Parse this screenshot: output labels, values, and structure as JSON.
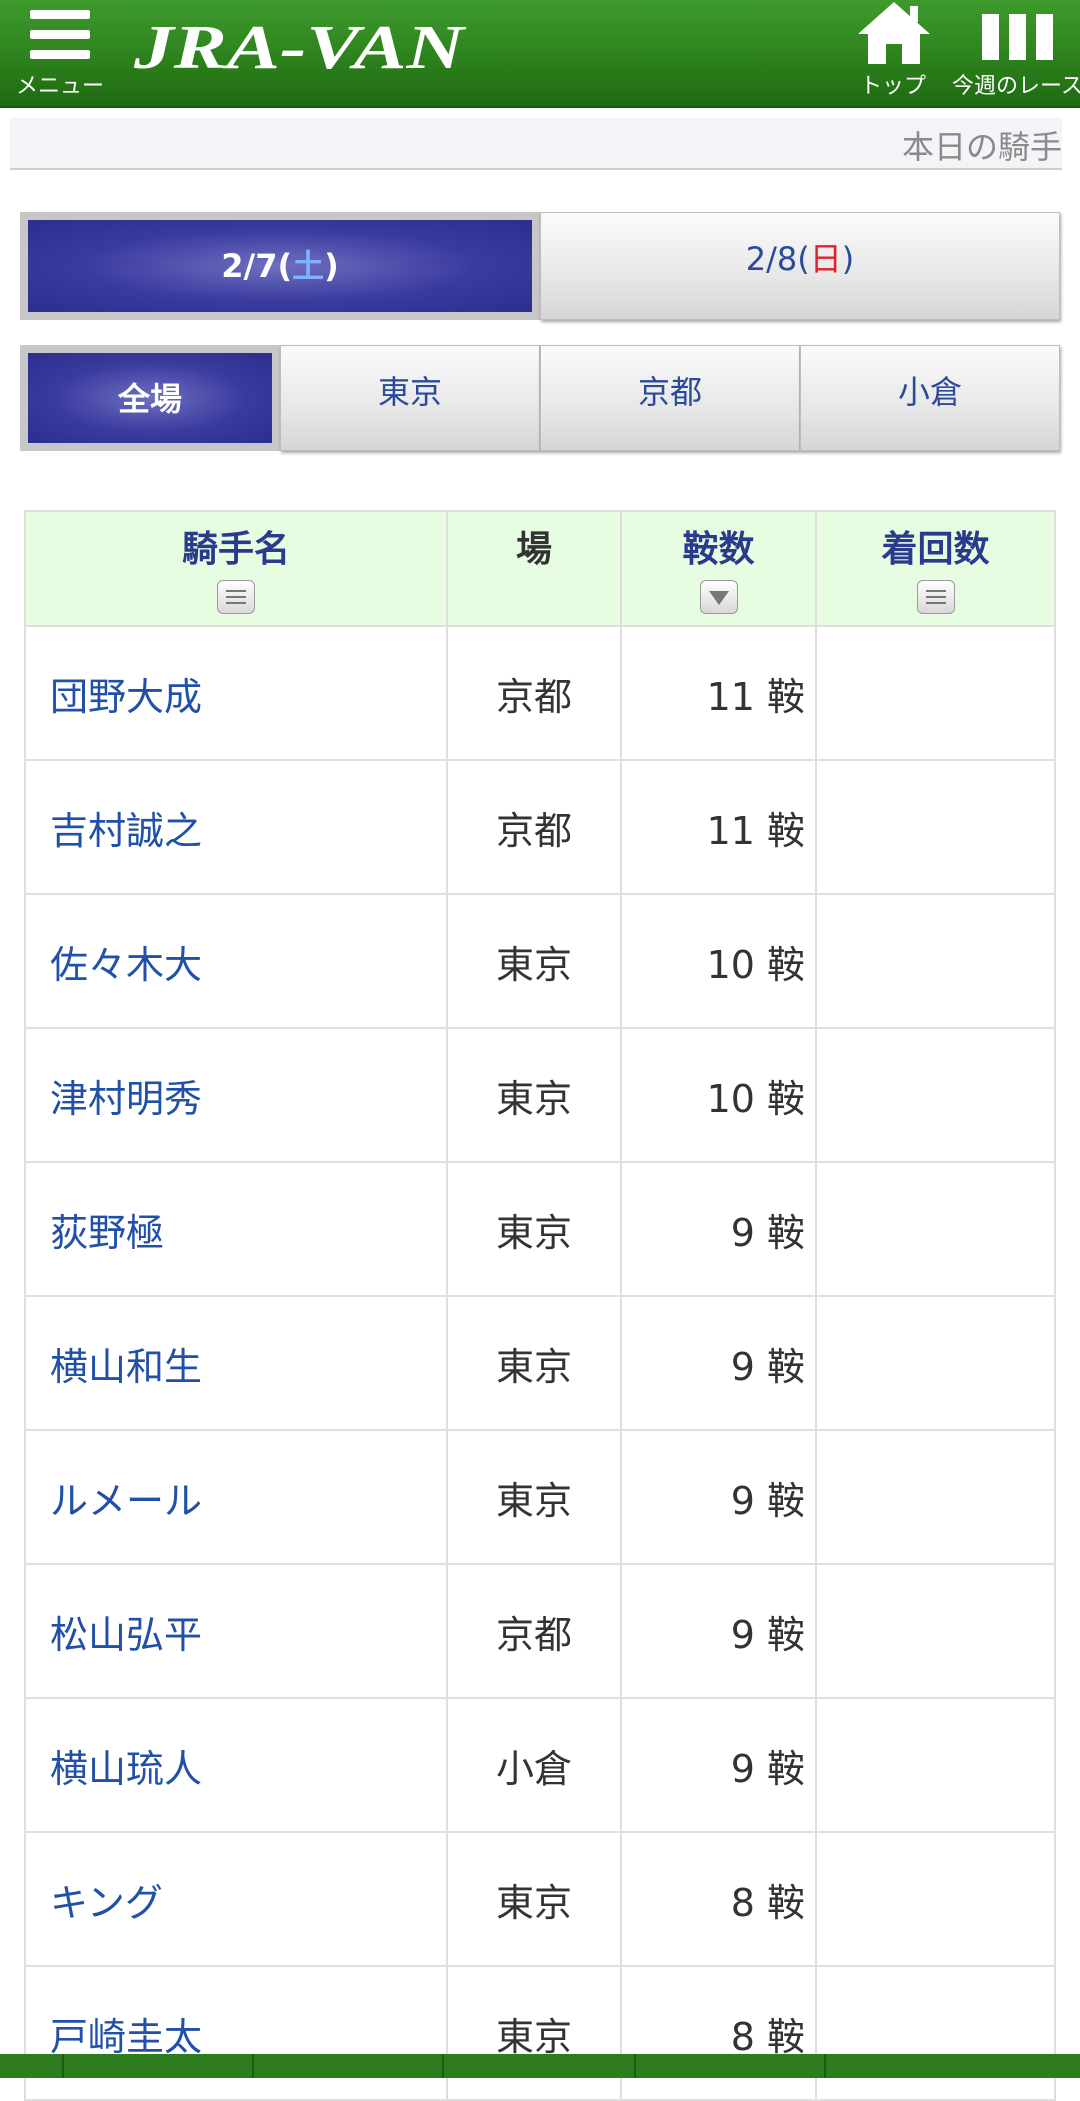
{
  "header": {
    "menu_label": "メニュー",
    "logo_text": "JRA-VAN",
    "top_label": "トップ",
    "races_label": "今週のレース"
  },
  "page": {
    "title": "本日の騎手"
  },
  "date_tabs": [
    {
      "date": "2/7(",
      "dow": "土",
      "close": ")",
      "active": true
    },
    {
      "date": "2/8(",
      "dow": "日",
      "close": ")",
      "active": false
    }
  ],
  "venue_tabs": [
    {
      "label": "全場",
      "active": true
    },
    {
      "label": "東京",
      "active": false
    },
    {
      "label": "京都",
      "active": false
    },
    {
      "label": "小倉",
      "active": false
    }
  ],
  "table": {
    "headers": {
      "name": "騎手名",
      "venue": "場",
      "rides": "鞍数",
      "places": "着回数"
    },
    "rows": [
      {
        "name": "団野大成",
        "venue": "京都",
        "rides": "11 鞍"
      },
      {
        "name": "吉村誠之",
        "venue": "京都",
        "rides": "11 鞍"
      },
      {
        "name": "佐々木大",
        "venue": "東京",
        "rides": "10 鞍"
      },
      {
        "name": "津村明秀",
        "venue": "東京",
        "rides": "10 鞍"
      },
      {
        "name": "荻野極",
        "venue": "東京",
        "rides": "9 鞍"
      },
      {
        "name": "横山和生",
        "venue": "東京",
        "rides": "9 鞍"
      },
      {
        "name": "ルメール",
        "venue": "東京",
        "rides": "9 鞍"
      },
      {
        "name": "松山弘平",
        "venue": "京都",
        "rides": "9 鞍"
      },
      {
        "name": "横山琉人",
        "venue": "小倉",
        "rides": "9 鞍"
      },
      {
        "name": "キング",
        "venue": "東京",
        "rides": "8 鞍"
      },
      {
        "name": "戸崎圭太",
        "venue": "東京",
        "rides": "8 鞍"
      }
    ]
  },
  "colors": {
    "header_green": "#2b7f1b",
    "active_tab": "#3a3b9f",
    "link_blue": "#2050a8",
    "table_header_bg": "#e6fde2"
  }
}
